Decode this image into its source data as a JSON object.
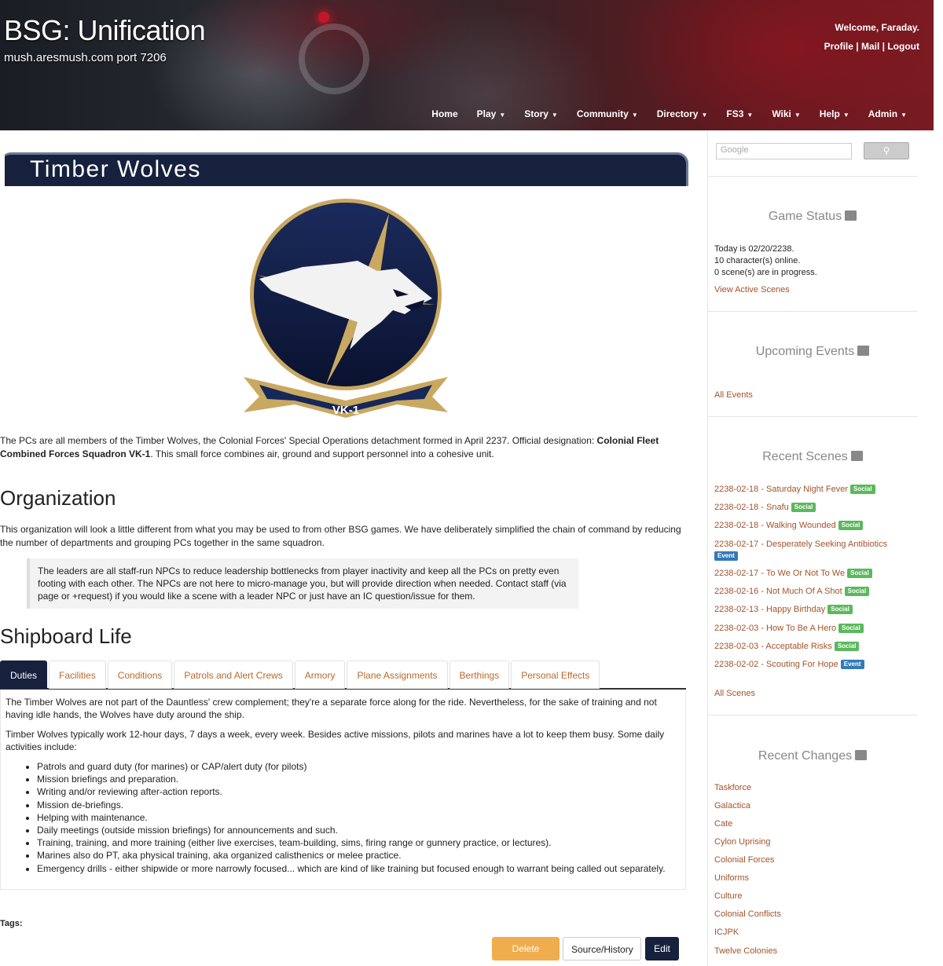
{
  "header": {
    "site_title": "BSG: Unification",
    "site_subtitle": "mush.aresmush.com port 7206",
    "welcome": "Welcome, Faraday.",
    "user_links": [
      "Profile",
      "Mail",
      "Logout"
    ],
    "nav": [
      "Home",
      "Play",
      "Story",
      "Community",
      "Directory",
      "FS3",
      "Wiki",
      "Help",
      "Admin"
    ]
  },
  "page": {
    "title": "Timber Wolves",
    "logo_text": "VK-1",
    "intro_pre": "The PCs are all members of the Timber Wolves, the Colonial Forces' Special Operations detachment formed in April 2237. Official designation: ",
    "intro_bold": "Colonial Fleet Combined Forces Squadron VK-1",
    "intro_post": ". This small force combines air, ground and support personnel into a cohesive unit.",
    "org_heading": "Organization",
    "org_text": "This organization will look a little different from what you may be used to from other BSG games. We have deliberately simplified the chain of command by reducing the number of departments and grouping PCs together in the same squadron.",
    "callout": "The leaders are all staff-run NPCs to reduce leadership bottlenecks from player inactivity and keep all the PCs on pretty even footing with each other. The NPCs are not here to micro-manage you, but will provide direction when needed. Contact staff (via page or +request) if you would like a scene with a leader NPC or just have an IC question/issue for them.",
    "ship_heading": "Shipboard Life",
    "tabs": [
      "Duties",
      "Facilities",
      "Conditions",
      "Patrols and Alert Crews",
      "Armory",
      "Plane Assignments",
      "Berthings",
      "Personal Effects"
    ],
    "tab_p1": "The Timber Wolves are not part of the Dauntless' crew complement; they're a separate force along for the ride. Nevertheless, for the sake of training and not having idle hands, the Wolves have duty around the ship.",
    "tab_p2": "Timber Wolves typically work 12-hour days, 7 days a week, every week. Besides active missions, pilots and marines have a lot to keep them busy. Some daily activities include:",
    "tab_list": [
      "Patrols and guard duty (for marines) or CAP/alert duty (for pilots)",
      "Mission briefings and preparation.",
      "Writing and/or reviewing after-action reports.",
      "Mission de-briefings.",
      "Helping with maintenance.",
      "Daily meetings (outside mission briefings) for announcements and such.",
      "Training, training, and more training (either live exercises, team-building, sims, firing range or gunnery practice, or lectures).",
      "Marines also do PT, aka physical training, aka organized calisthenics or melee practice.",
      "Emergency drills - either shipwide or more narrowly focused... which are kind of like training but focused enough to warrant being called out separately."
    ],
    "tags_label": "Tags:",
    "buttons": {
      "delete": "Delete Page",
      "source": "Source/History",
      "edit": "Edit"
    }
  },
  "sidebar": {
    "search_placeholder": "Google",
    "game_status": {
      "title": "Game Status",
      "line1": "Today is 02/20/2238.",
      "line2": "10 character(s) online.",
      "line3": "0 scene(s) are in progress.",
      "link": "View Active Scenes"
    },
    "events": {
      "title": "Upcoming Events",
      "link": "All Events"
    },
    "scenes": {
      "title": "Recent Scenes",
      "items": [
        {
          "label": "2238-02-18 - Saturday Night Fever",
          "badge": "Social"
        },
        {
          "label": "2238-02-18 - Snafu",
          "badge": "Social"
        },
        {
          "label": "2238-02-18 - Walking Wounded",
          "badge": "Social"
        },
        {
          "label": "2238-02-17 - Desperately Seeking Antibiotics",
          "badge": "Event"
        },
        {
          "label": "2238-02-17 - To We Or Not To We",
          "badge": "Social"
        },
        {
          "label": "2238-02-16 - Not Much Of A Shot",
          "badge": "Social"
        },
        {
          "label": "2238-02-13 - Happy Birthday",
          "badge": "Social"
        },
        {
          "label": "2238-02-03 - How To Be A Hero",
          "badge": "Social"
        },
        {
          "label": "2238-02-03 - Acceptable Risks",
          "badge": "Social"
        },
        {
          "label": "2238-02-02 - Scouting For Hope",
          "badge": "Event"
        }
      ],
      "link": "All Scenes"
    },
    "changes": {
      "title": "Recent Changes",
      "items": [
        "Taskforce",
        "Galactica",
        "Cate",
        "Cylon Uprising",
        "Colonial Forces",
        "Uniforms",
        "Culture",
        "Colonial Conflicts",
        "ICJPK",
        "Twelve Colonies"
      ]
    }
  },
  "colors": {
    "navy": "#16213d",
    "link": "#a3532a",
    "social": "#5cb85c",
    "event": "#337ab7",
    "warning": "#f0ad4e"
  }
}
